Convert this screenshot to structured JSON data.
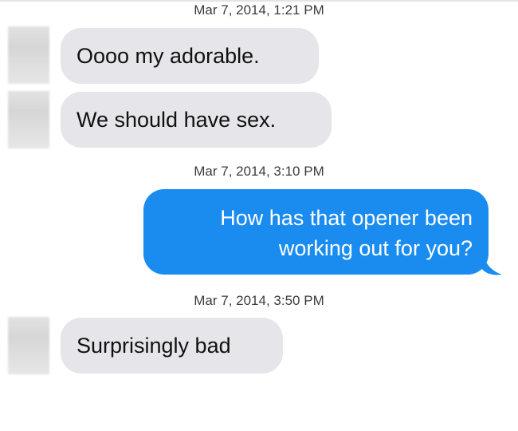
{
  "conversation": {
    "messages": [
      {
        "timestamp": "Mar 7, 2014, 1:21 PM"
      },
      {
        "text": "Oooo my adorable.",
        "direction": "received"
      },
      {
        "text": "We should have sex.",
        "direction": "received"
      },
      {
        "timestamp": "Mar 7, 2014, 3:10 PM"
      },
      {
        "text_line1": "How has that opener been",
        "text_line2": "working out for you?",
        "direction": "sent"
      },
      {
        "timestamp": "Mar 7, 2014, 3:50 PM"
      },
      {
        "text": "Surprisingly bad",
        "direction": "received"
      }
    ]
  },
  "colors": {
    "received_bubble": "#e5e5ea",
    "sent_bubble": "#1a8cf0",
    "timestamp_text": "#3c3c3c"
  }
}
